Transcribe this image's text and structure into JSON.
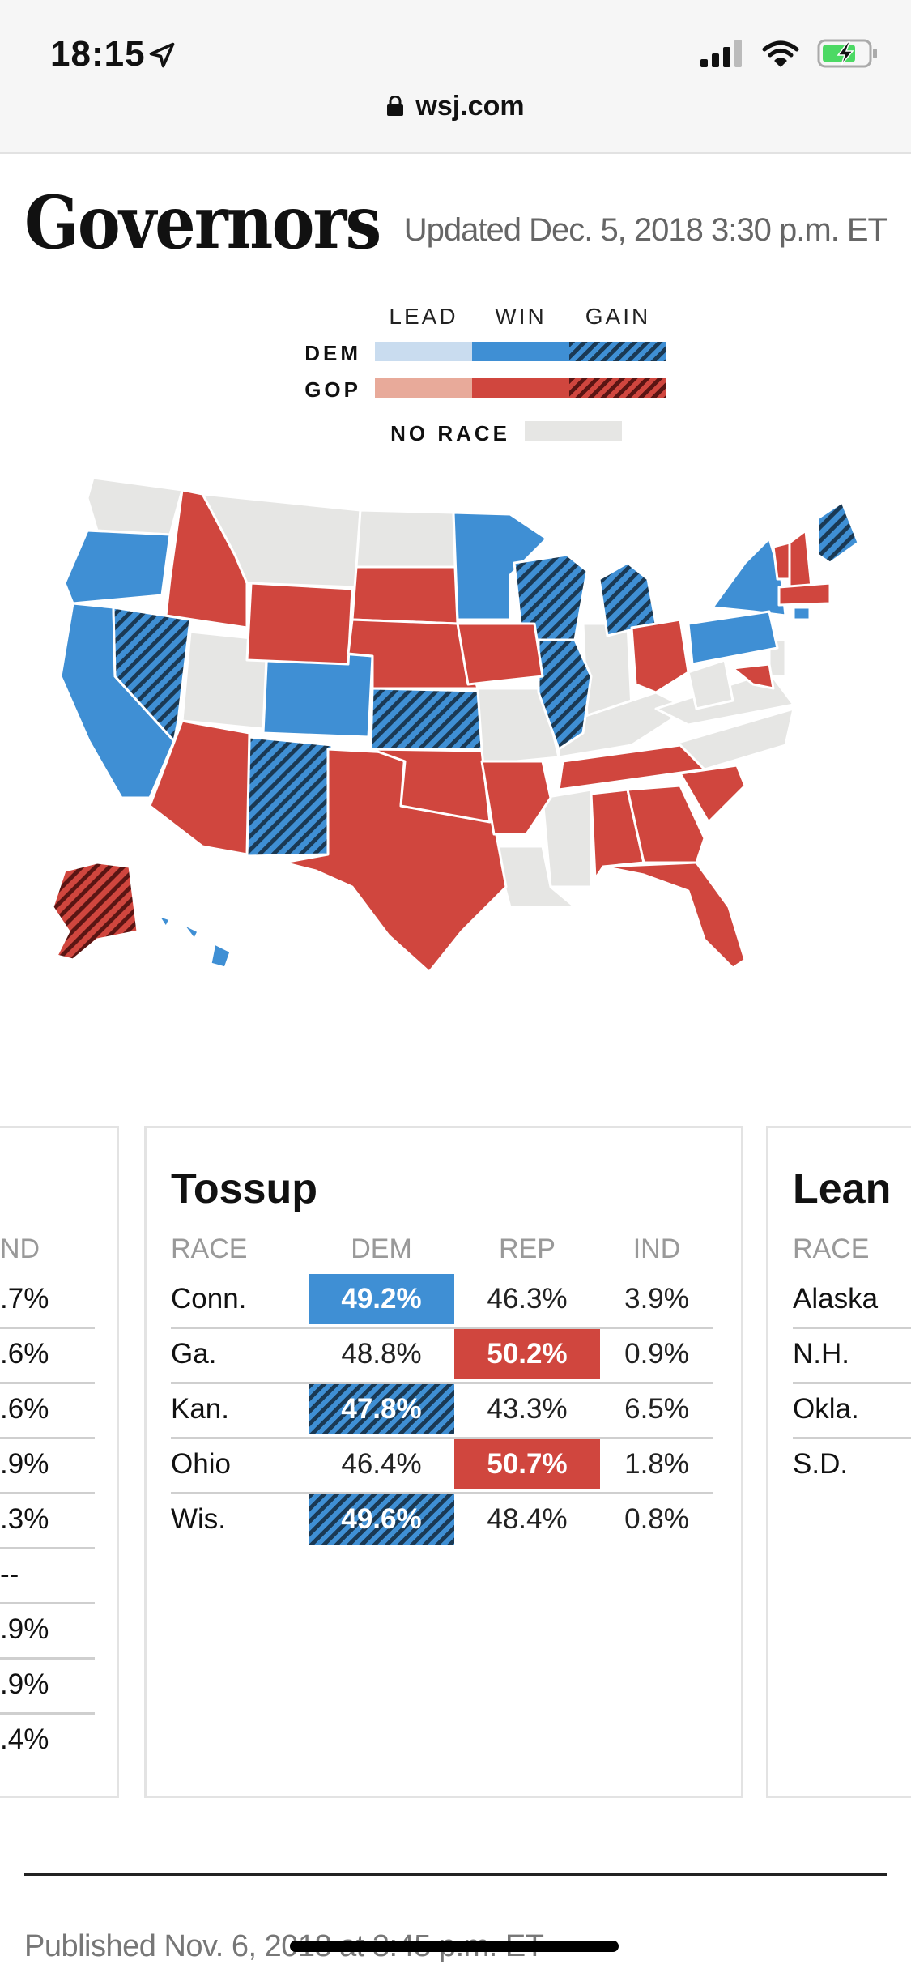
{
  "status": {
    "time": "18:15",
    "url": "wsj.com",
    "icons": [
      "location-arrow-icon",
      "signal-icon",
      "wifi-icon",
      "battery-charging-icon",
      "lock-icon"
    ]
  },
  "header": {
    "title": "Governors",
    "updated": "Updated Dec. 5, 2018 3:30 p.m. ET"
  },
  "legend": {
    "columns": [
      "LEAD",
      "WIN",
      "GAIN"
    ],
    "rows": [
      "DEM",
      "GOP"
    ],
    "no_race": "NO RACE",
    "colors": {
      "dem_lead": "#c9dcef",
      "dem_win": "#3f8fd4",
      "gop_lead": "#e8aa9a",
      "gop_win": "#d0463e",
      "no_race": "#e6e6e4"
    }
  },
  "map": {
    "states": {
      "dem_win": [
        "Oregon",
        "California",
        "Colorado",
        "Minnesota",
        "New York",
        "Pennsylvania",
        "Rhode Island",
        "Hawaii"
      ],
      "dem_gain": [
        "Nevada",
        "New Mexico",
        "Kansas",
        "Wisconsin",
        "Illinois",
        "Michigan",
        "Maine"
      ],
      "gop_win": [
        "Idaho",
        "Wyoming",
        "South Dakota",
        "Nebraska",
        "Iowa",
        "Arizona",
        "Texas",
        "Oklahoma",
        "Arkansas",
        "Ohio",
        "Tennessee",
        "Alabama",
        "Georgia",
        "South Carolina",
        "Florida",
        "Vermont",
        "New Hampshire",
        "Massachusetts",
        "Maryland"
      ],
      "gop_gain": [
        "Alaska"
      ]
    }
  },
  "cards": {
    "left": {
      "col_header": "ND",
      "values": [
        ".7%",
        ".6%",
        ".6%",
        ".9%",
        ".3%",
        "--",
        ".9%",
        ".9%",
        ".4%"
      ]
    },
    "tossup": {
      "title": "Tossup",
      "headers": [
        "RACE",
        "DEM",
        "REP",
        "IND"
      ],
      "rows": [
        {
          "race": "Conn.",
          "dem": "49.2%",
          "rep": "46.3%",
          "ind": "3.9%",
          "winner": "dem",
          "gain": false
        },
        {
          "race": "Ga.",
          "dem": "48.8%",
          "rep": "50.2%",
          "ind": "0.9%",
          "winner": "rep",
          "gain": false
        },
        {
          "race": "Kan.",
          "dem": "47.8%",
          "rep": "43.3%",
          "ind": "6.5%",
          "winner": "dem",
          "gain": true
        },
        {
          "race": "Ohio",
          "dem": "46.4%",
          "rep": "50.7%",
          "ind": "1.8%",
          "winner": "rep",
          "gain": false
        },
        {
          "race": "Wis.",
          "dem": "49.6%",
          "rep": "48.4%",
          "ind": "0.8%",
          "winner": "dem",
          "gain": true
        }
      ]
    },
    "right": {
      "title": "Lean",
      "col_header": "RACE",
      "races": [
        "Alaska",
        "N.H.",
        "Okla.",
        "S.D."
      ]
    }
  },
  "footer": {
    "published": "Published Nov. 6, 2018 at 3:45 p.m. ET"
  }
}
